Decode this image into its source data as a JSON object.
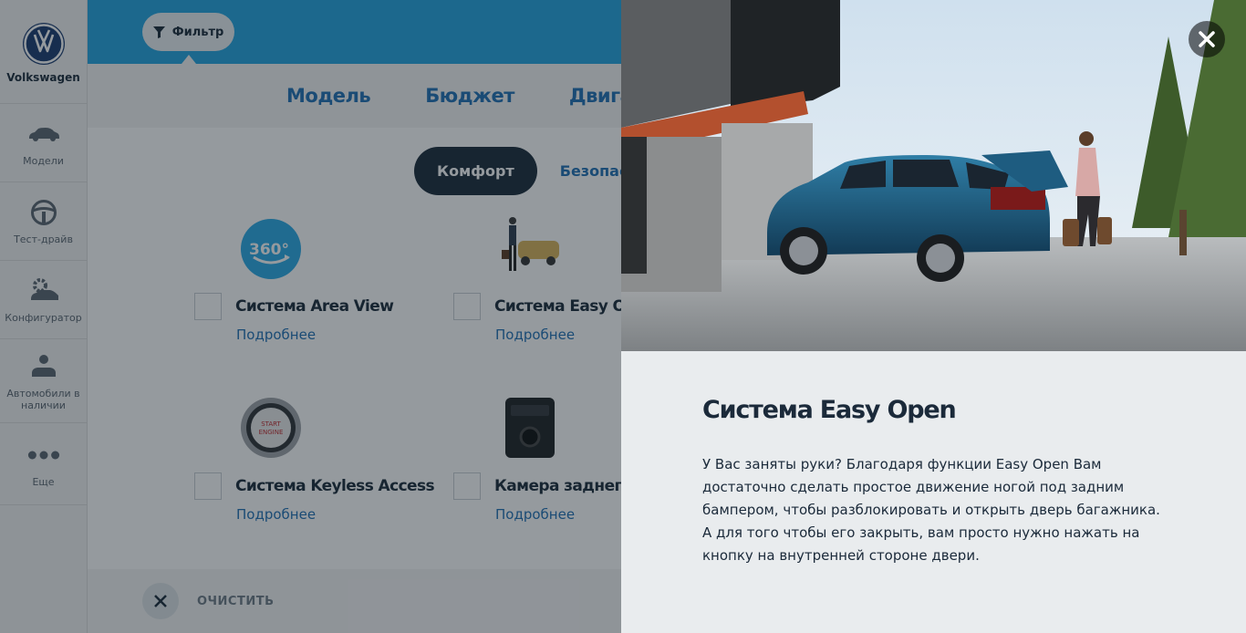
{
  "brand": {
    "name": "Volkswagen"
  },
  "sidebar": {
    "items": [
      {
        "label": "Модели",
        "icon": "car-icon"
      },
      {
        "label": "Тест-драйв",
        "icon": "steering-wheel-icon"
      },
      {
        "label": "Конфигуратор",
        "icon": "configurator-icon"
      },
      {
        "label": "Автомобили в наличии",
        "icon": "person-car-icon"
      },
      {
        "label": "Еще",
        "icon": "more-dots-icon"
      }
    ]
  },
  "filter": {
    "label": "Фильтр",
    "icon": "filter-icon"
  },
  "tabs": [
    "Модель",
    "Бюджет",
    "Двигате"
  ],
  "subtabs": {
    "active": "Комфорт",
    "next": "Безопасно"
  },
  "options": [
    {
      "title": "Система Area View",
      "more": "Подробнее",
      "icon": "360-view-icon"
    },
    {
      "title": "Система Easy Open",
      "more": "Подробнее",
      "icon": "easy-open-photo"
    },
    {
      "title": "Система Keyless Access",
      "more": "Подробнее",
      "icon": "start-button-icon"
    },
    {
      "title": "Камера заднего ви",
      "more": "Подробнее",
      "icon": "rear-camera-icon"
    }
  ],
  "bottom": {
    "clear_label": "ОЧИСТИТЬ"
  },
  "modal": {
    "title": "Система Easy Open",
    "text": "У Вас заняты руки? Благодаря функции Easy Open Вам достаточно сделать простое движение ногой под задним бампером, чтобы разблокировать и открыть дверь багажника. А для того чтобы его закрыть, вам просто нужно нажать на кнопку на внутренней стороне двери.",
    "close_icon": "close-icon"
  },
  "colors": {
    "accent": "#24a5e0",
    "link": "#1f6fb4",
    "dark": "#1b2a3a"
  }
}
